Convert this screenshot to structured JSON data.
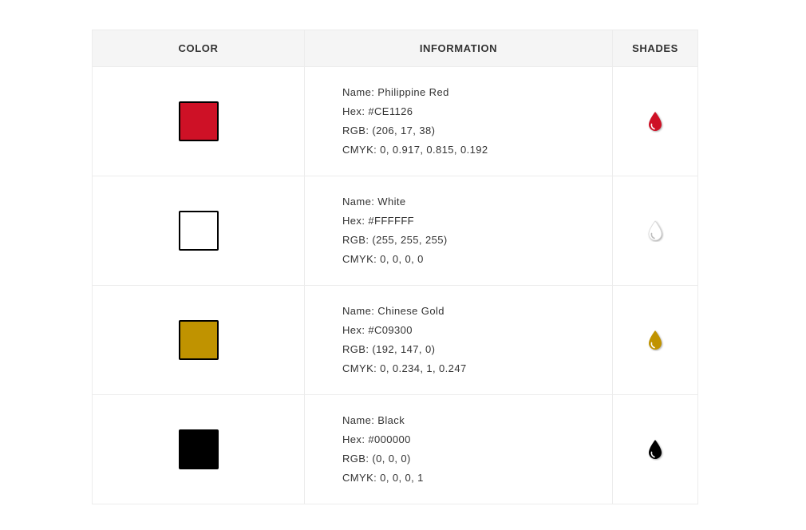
{
  "header": {
    "color": "COLOR",
    "information": "INFORMATION",
    "shades": "SHADES"
  },
  "rows": [
    {
      "swatch_color": "#CE1126",
      "name": "Name: Philippine Red",
      "hex": "Hex: #CE1126",
      "rgb": "RGB: (206, 17, 38)",
      "cmyk": "CMYK: 0, 0.917, 0.815, 0.192",
      "shade_icon": "drop-icon"
    },
    {
      "swatch_color": "#FFFFFF",
      "name": "Name: White",
      "hex": "Hex: #FFFFFF",
      "rgb": "RGB: (255, 255, 255)",
      "cmyk": "CMYK: 0, 0, 0, 0",
      "shade_icon": "drop-icon"
    },
    {
      "swatch_color": "#C09300",
      "name": "Name: Chinese Gold",
      "hex": "Hex: #C09300",
      "rgb": "RGB: (192, 147, 0)",
      "cmyk": "CMYK: 0, 0.234, 1, 0.247",
      "shade_icon": "drop-icon"
    },
    {
      "swatch_color": "#000000",
      "name": "Name: Black",
      "hex": "Hex: #000000",
      "rgb": "RGB: (0, 0, 0)",
      "cmyk": "CMYK: 0, 0, 0, 1",
      "shade_icon": "drop-icon"
    }
  ]
}
